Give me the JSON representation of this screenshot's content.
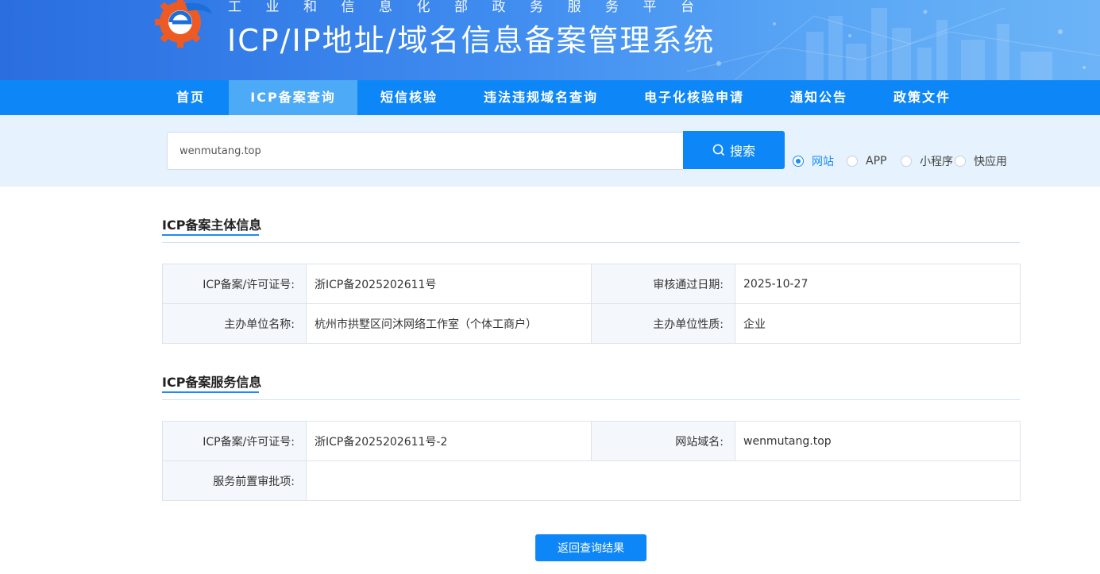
{
  "header": {
    "subtitle": "工业和信息化部政务服务平台",
    "title": "ICP/IP地址/域名信息备案管理系统"
  },
  "nav": {
    "items": [
      {
        "label": "首页"
      },
      {
        "label": "ICP备案查询"
      },
      {
        "label": "短信核验"
      },
      {
        "label": "违法违规域名查询"
      },
      {
        "label": "电子化核验申请"
      },
      {
        "label": "通知公告"
      },
      {
        "label": "政策文件"
      }
    ],
    "active": "ICP备案查询"
  },
  "search": {
    "value": "wenmutang.top",
    "button_label": "搜索",
    "options": [
      "网站",
      "APP",
      "小程序",
      "快应用"
    ],
    "selected": "网站"
  },
  "subject_section": {
    "title": "ICP备案主体信息",
    "license_label": "ICP备案/许可证号:",
    "license_value": "浙ICP备2025202611号",
    "approve_date_label": "审核通过日期:",
    "approve_date_value": "2025-10-27",
    "org_name_label": "主办单位名称:",
    "org_name_value": "杭州市拱墅区问沐网络工作室（个体工商户）",
    "org_type_label": "主办单位性质:",
    "org_type_value": "企业"
  },
  "service_section": {
    "title": "ICP备案服务信息",
    "license_label": "ICP备案/许可证号:",
    "license_value": "浙ICP备2025202611号-2",
    "domain_label": "网站域名:",
    "domain_value": "wenmutang.top",
    "preapproval_label": "服务前置审批项:",
    "preapproval_value": ""
  },
  "back_button_label": "返回查询结果",
  "colors": {
    "primary": "#0d87f7",
    "nav_active": "#4daaf7",
    "search_band": "#e6f2fd",
    "logo_orange": "#ee5a24"
  }
}
